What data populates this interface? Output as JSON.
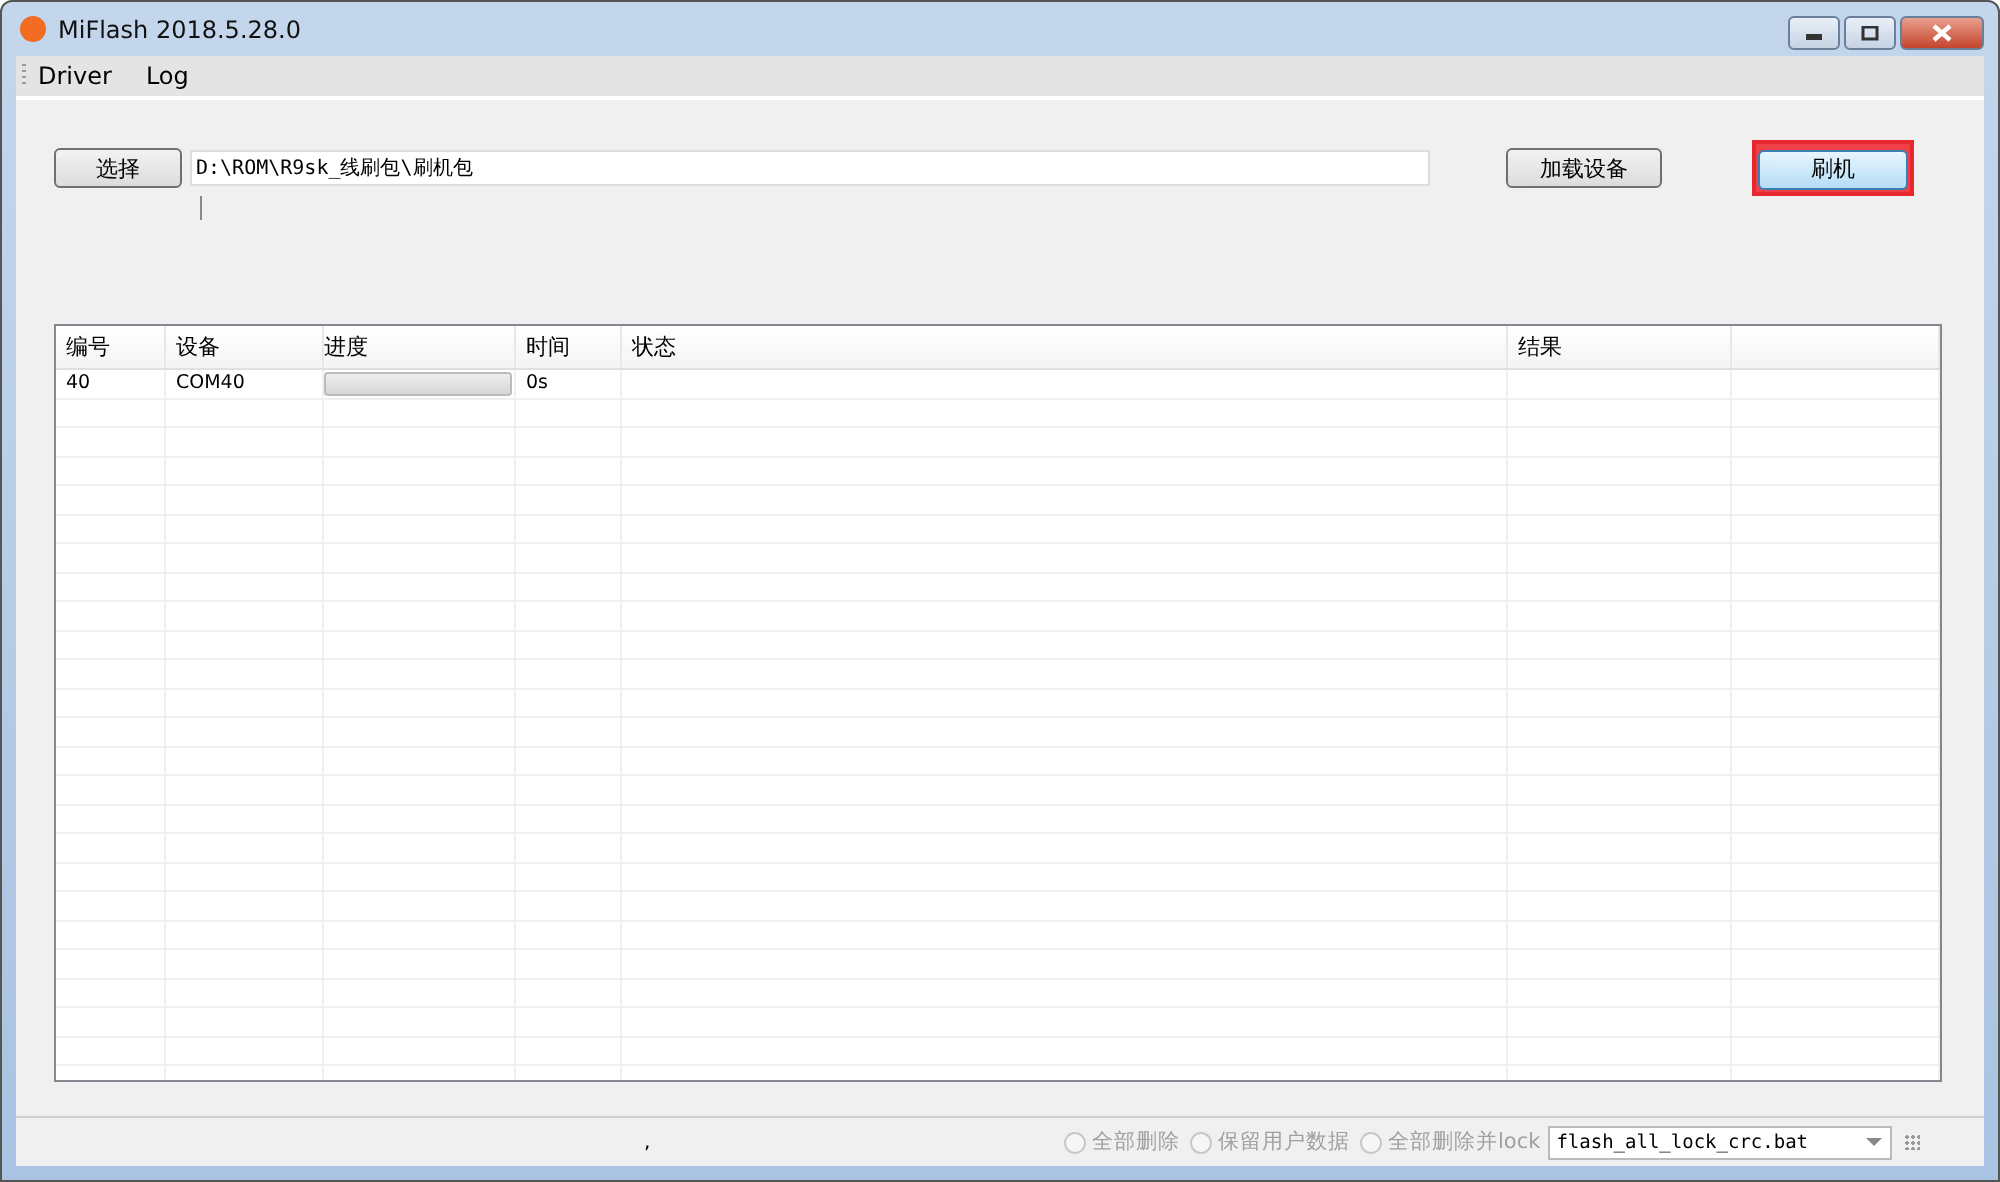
{
  "window": {
    "title": "MiFlash 2018.5.28.0"
  },
  "menu": [
    "Driver",
    "Log"
  ],
  "toolbar": {
    "select_button": "选择",
    "path": "D:\\ROM\\R9sk_线刷包\\刷机包",
    "load_button": "加载设备",
    "flash_button": "刷机",
    "flash_highlighted": true
  },
  "table": {
    "columns": [
      "编号",
      "设备",
      "进度",
      "时间",
      "状态",
      "结果"
    ],
    "rows": [
      {
        "number": "40",
        "device": "COM40",
        "level": 0,
        "time": "0s",
        "status": "",
        "result": ""
      }
    ]
  },
  "status_bar": {
    "text": ",",
    "options": [
      {
        "label": "全部删除",
        "selected": false,
        "disabled": true
      },
      {
        "label": "保留用户数据",
        "selected": false,
        "disabled": true
      },
      {
        "label": "全部删除并lock",
        "selected": false,
        "disabled": true
      }
    ],
    "script": "flash_all_lock_crc.bat"
  }
}
